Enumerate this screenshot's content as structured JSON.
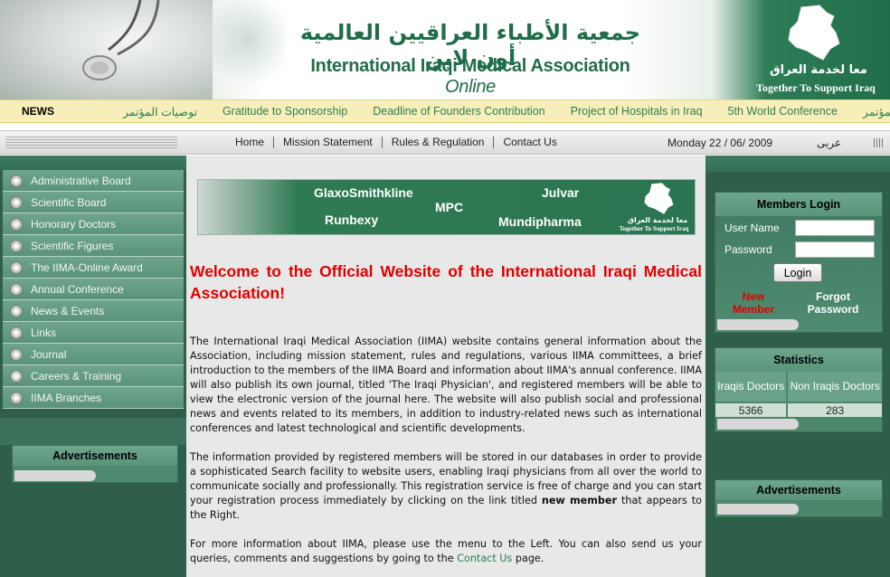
{
  "header": {
    "title_ar": "جمعية الأطباء العراقيين العالمية أون لاين",
    "title_en": "International Iraqi Medical Association",
    "title_en_suffix": "Online",
    "slogan_ar": "معا لخدمة العراق",
    "slogan_en": "Together To Support Iraq"
  },
  "news": {
    "label": "NEWS",
    "items": [
      "توصيات المؤتمر",
      "Gratitude to Sponsorship",
      "Deadline of Founders Contribution",
      "Project of Hospitals in Iraq",
      "5th World Conference",
      "ج المؤتمر"
    ]
  },
  "topnav": {
    "links": [
      "Home",
      "Mission Statement",
      "Rules & Regulation",
      "Contact Us"
    ],
    "date": "Monday 22 / 06/ 2009",
    "lang": "عربى"
  },
  "sidebar": {
    "items": [
      "Administrative Board",
      "Scientific Board",
      "Honorary Doctors",
      "Scientific Figures",
      "The IIMA-Online Award",
      "Annual Conference",
      "News & Events",
      "Links",
      "Journal",
      "Careers & Training",
      "IIMA Branches"
    ],
    "ads_title": "Advertisements"
  },
  "sponsors": {
    "names": [
      "GlaxoSmithkline",
      "MPC",
      "Julvar",
      "Runbexy",
      "Mundipharma"
    ],
    "caption_ar": "معا لخدمة العراق",
    "caption_en": "Together To Support Iraq"
  },
  "main": {
    "welcome": "Welcome to the Official Website of the International Iraqi Medical Association!",
    "p1": "The International Iraqi Medical Association (IIMA) website contains general information about the Association, including mission statement, rules and regulations, various IIMA committees, a brief introduction to the members of the IIMA Board and information about IIMA's annual conference. IIMA will also publish its own journal, titled 'The Iraqi Physician', and registered members will be able to view the electronic version of the journal here. The website will also publish social and professional news and events related to its members, in addition to industry-related news such as international conferences and latest technological and scientific developments.",
    "p2_start": "The information provided by registered members will be stored in our databases in order to provide a sophisticated Search facility to website users, enabling Iraqi physicians from all over the world to communicate socially and professionally. This registration service is free of charge and you can start your registration process immediately by clicking on the link titled",
    "p2_link": "new member",
    "p2_end": "that appears to the Right.",
    "p3_start": "For more information about IIMA, please use the menu to the Left. You can also send us your queries, comments and suggestions by going to the",
    "p3_link": "Contact Us",
    "p3_end": "page."
  },
  "login": {
    "title": "Members Login",
    "username_label": "User Name",
    "password_label": "Password",
    "button": "Login",
    "new_member": "New Member",
    "forgot_password": "Forgot Password"
  },
  "stats": {
    "title": "Statistics",
    "col1": "Iraqis Doctors",
    "col2": "Non Iraqis Doctors",
    "val1": "5366",
    "val2": "283"
  },
  "right_ads": {
    "title": "Advertisements"
  }
}
